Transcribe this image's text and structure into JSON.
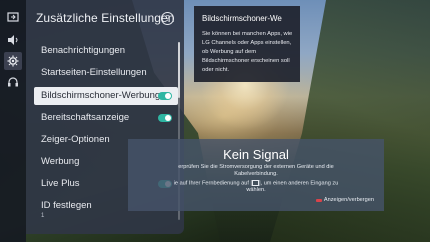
{
  "rail": {
    "icons": [
      "input-icon",
      "volume-icon",
      "gear-icon",
      "support-icon"
    ]
  },
  "panel": {
    "title": "Zusätzliche Einstellungen",
    "items": [
      {
        "label": "Benachrichtigungen",
        "toggle": null
      },
      {
        "label": "Startseiten-Einstellungen",
        "toggle": null
      },
      {
        "label": "Bildschirmschoner-Werbung",
        "toggle": "on"
      },
      {
        "label": "Bereitschaftsanzeige",
        "toggle": "on"
      },
      {
        "label": "Zeiger-Optionen",
        "toggle": null
      },
      {
        "label": "Werbung",
        "toggle": null
      },
      {
        "label": "Live Plus",
        "toggle": "on"
      },
      {
        "label": "ID festlegen",
        "toggle": null
      }
    ],
    "id_value": "1",
    "selected_index": 2
  },
  "tooltip": {
    "title": "Bildschirmschoner-We",
    "body": "Sie können bei manchen Apps, wie LG Channels oder Apps einstellen, ob Werbung auf dem Bildschirmschoner erscheinen soll oder nicht."
  },
  "no_signal": {
    "title": "Kein Signal",
    "line1": "erprüfen Sie die Stromversorgung der externen Geräte und die",
    "line2": "Kabelverbindung.",
    "line3": "ie auf Ihrer Fernbedienung auf [",
    "line3_icon": "input-icon",
    "line3_end": "], um einen anderen Eingang zu",
    "line4": "wählen.",
    "action": "Anzeigen/verbergen"
  },
  "colors": {
    "toggle_on": "#2fb6a3",
    "panel_bg": "#303646",
    "selected_bg": "#eceef2"
  }
}
